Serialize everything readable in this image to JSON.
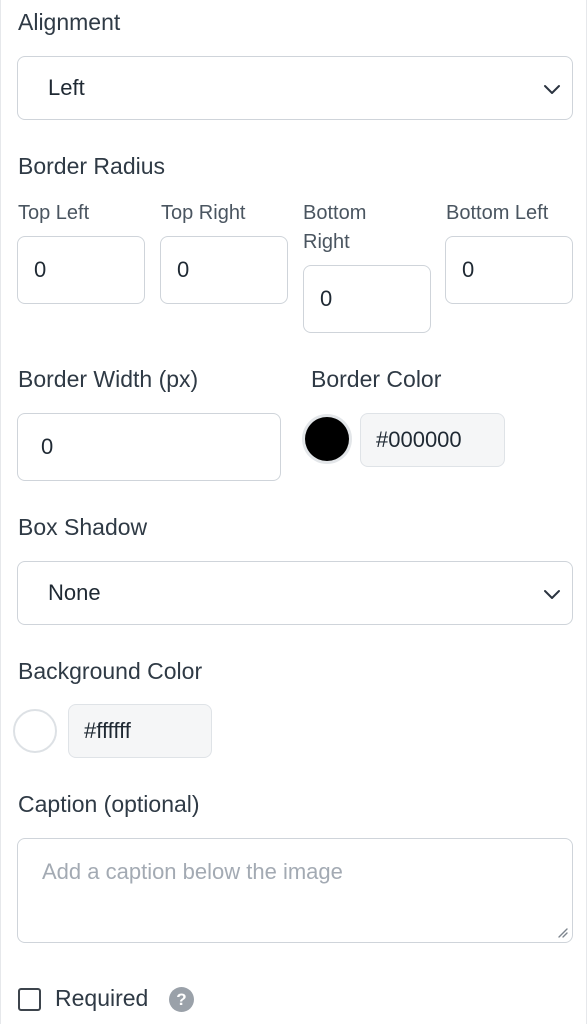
{
  "alignment": {
    "label": "Alignment",
    "selected": "Left"
  },
  "border_radius": {
    "label": "Border Radius",
    "top_left": {
      "label": "Top Left",
      "value": "0"
    },
    "top_right": {
      "label": "Top Right",
      "value": "0"
    },
    "bottom_right": {
      "label_line1": "Bottom",
      "label_line2": "Right",
      "value": "0"
    },
    "bottom_left": {
      "label": "Bottom Left",
      "value": "0"
    }
  },
  "border_width": {
    "label": "Border Width (px)",
    "value": "0"
  },
  "border_color": {
    "label": "Border Color",
    "hex": "#000000",
    "swatch_color": "#000000"
  },
  "box_shadow": {
    "label": "Box Shadow",
    "selected": "None"
  },
  "background_color": {
    "label": "Background Color",
    "hex": "#ffffff",
    "swatch_color": "#ffffff"
  },
  "caption": {
    "label": "Caption (optional)",
    "placeholder": "Add a caption below the image"
  },
  "required": {
    "label": "Required",
    "checked": false,
    "help_icon": "?"
  },
  "icons": {
    "select_chevron": "chevron-down-icon",
    "help": "question-circle-icon",
    "resize": "resize-grip-icon"
  }
}
